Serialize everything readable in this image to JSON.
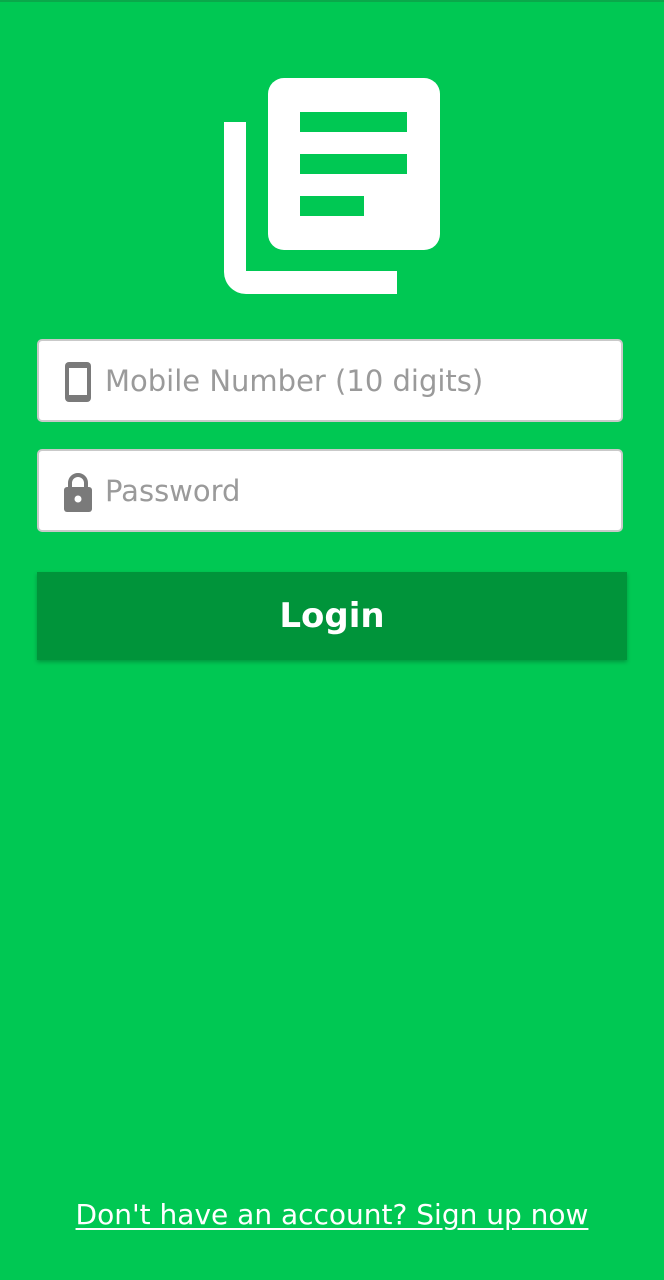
{
  "app": {
    "logo_icon": "news-articles-icon"
  },
  "form": {
    "mobile": {
      "icon": "smartphone-icon",
      "placeholder": "Mobile Number (10 digits)",
      "value": ""
    },
    "password": {
      "icon": "lock-icon",
      "placeholder": "Password",
      "value": ""
    },
    "login_label": "Login"
  },
  "footer": {
    "signup_text": "Don't have an account? Sign up now"
  },
  "colors": {
    "background": "#00C853",
    "button": "#00943A",
    "text": "#FFFFFF",
    "icon": "#7A7A7A"
  }
}
